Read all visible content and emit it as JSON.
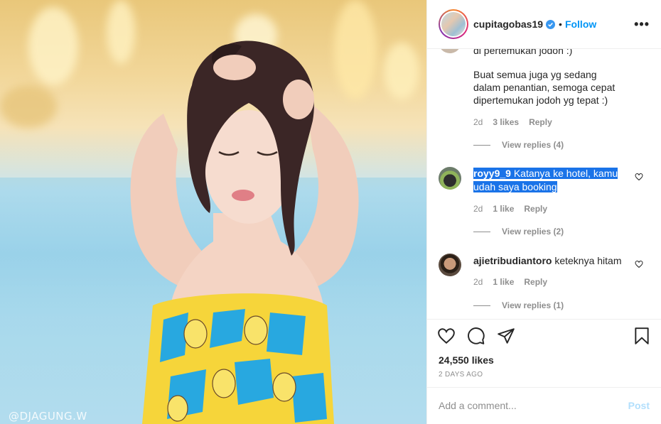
{
  "photo": {
    "watermark": "@DJAGUNG.W"
  },
  "header": {
    "username": "cupitagobas19",
    "separator": "•",
    "follow_label": "Follow",
    "more_label": "•••"
  },
  "comments": {
    "partial_top": "di pertemukan jodoh :)",
    "first": {
      "text_line1": "Buat semua juga yg sedang",
      "text_line2": "dalam penantian, semoga cepat",
      "text_line3": "dipertemukan jodoh yg tepat :)",
      "age": "2d",
      "likes": "3 likes",
      "reply": "Reply",
      "view_replies": "View replies (4)"
    },
    "second": {
      "username": "royy9_9",
      "text_line1": "Katanya ke hotel, kamu",
      "text_line2": "udah saya booking",
      "age": "2d",
      "likes": "1 like",
      "reply": "Reply",
      "view_replies": "View replies (2)"
    },
    "third": {
      "username": "ajietribudiantoro",
      "text": "keteknya hitam",
      "age": "2d",
      "likes": "1 like",
      "reply": "Reply",
      "view_replies": "View replies (1)"
    }
  },
  "actions": {
    "like_icon": "heart-icon",
    "comment_icon": "comment-icon",
    "share_icon": "paper-plane-icon",
    "save_icon": "bookmark-icon"
  },
  "stats": {
    "likes": "24,550 likes",
    "date": "2 DAYS AGO"
  },
  "composer": {
    "placeholder": "Add a comment...",
    "post_label": "Post"
  },
  "colors": {
    "accent": "#0095f6",
    "selection": "#1a73e8",
    "muted": "#8e8e8e",
    "text": "#262626"
  }
}
